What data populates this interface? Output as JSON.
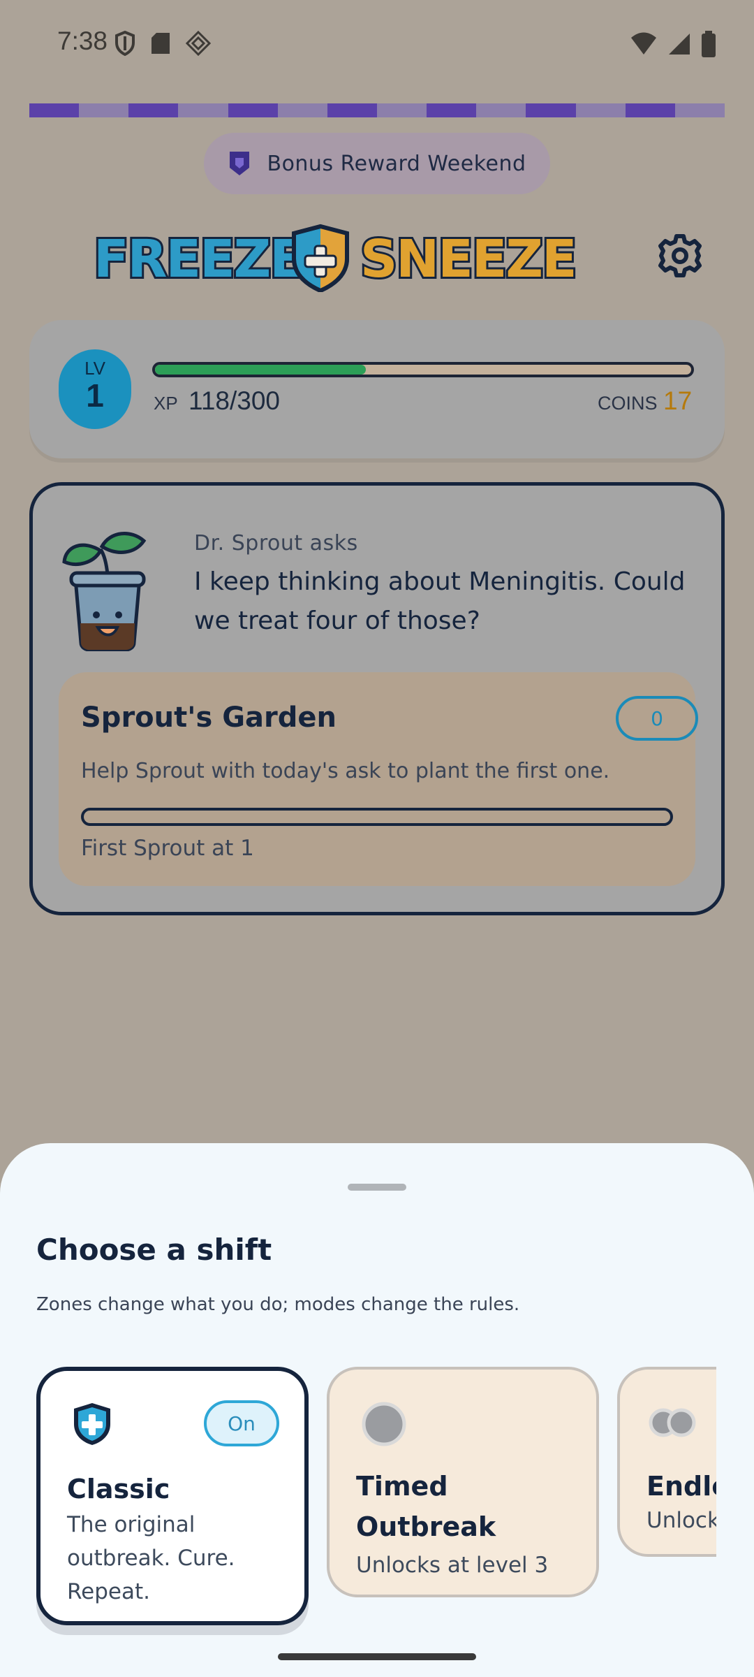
{
  "status_bar": {
    "time": "7:38",
    "left_icons": [
      "shield-icon",
      "sd-card-icon",
      "diamond-grid-icon"
    ],
    "right_icons": [
      "wifi-icon",
      "signal-icon",
      "battery-icon"
    ]
  },
  "colors": {
    "segment_dark": "#5b41a9",
    "segment_light": "#8c7fab",
    "accent_blue": "#1b91be",
    "xp_green": "#2c9e57",
    "coins_gold": "#b57a0c",
    "dark_navy": "#15243d"
  },
  "event": {
    "label": "Bonus Reward Weekend",
    "icon": "shield-badge-icon"
  },
  "header": {
    "logo_text_left": "FREEZE",
    "logo_text_right": "SNEEZE",
    "settings_icon": "gear-icon"
  },
  "level": {
    "label": "LV",
    "number": "1",
    "xp_label": "XP",
    "xp_value": "118/300",
    "xp_fraction": 0.393,
    "coins_label": "COINS",
    "coins_value": "17"
  },
  "quest": {
    "asker": "Dr. Sprout asks",
    "text": "I keep thinking about Meningitis. Could we treat four of those?",
    "garden": {
      "title": "Sprout's Garden",
      "count": "0",
      "description": "Help Sprout with today's ask to plant the first one.",
      "progress_fraction": 0,
      "next_label": "First Sprout at 1"
    }
  },
  "sheet": {
    "title": "Choose a shift",
    "subtitle": "Zones change what you do; modes change the rules.",
    "cards": [
      {
        "title": "Classic",
        "description": "The original outbreak. Cure. Repeat.",
        "badge": "On",
        "icon": "shield-cross-icon"
      },
      {
        "title": "Timed Outbreak",
        "description": "Unlocks at level 3",
        "icon": "gray-circle-icon"
      },
      {
        "title": "Endless",
        "description": "Unlocks",
        "icon": "double-circle-icon"
      }
    ]
  }
}
